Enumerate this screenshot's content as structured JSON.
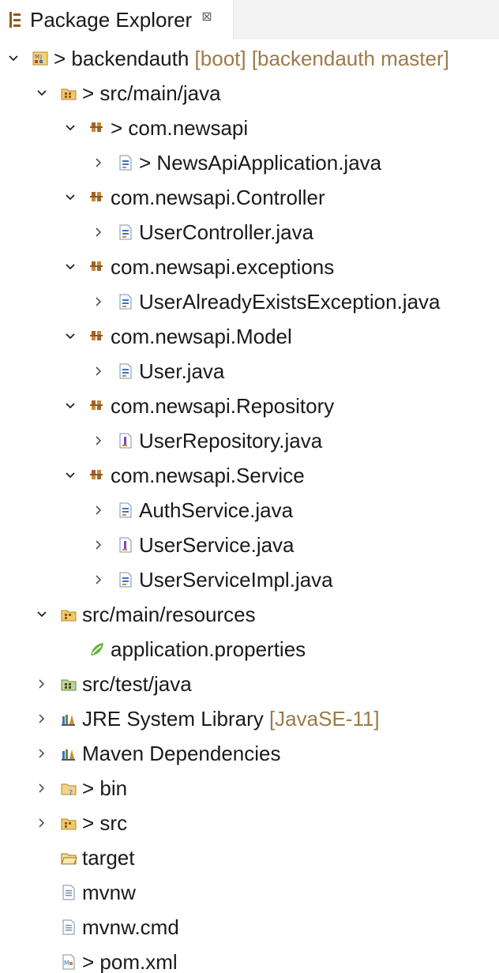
{
  "view": {
    "title": "Package Explorer",
    "close_glyph": "⊠",
    "icon": "package-explorer-icon"
  },
  "tree": [
    {
      "id": "project",
      "indent": 0,
      "twisty": "open",
      "icon": "maven-project-icon",
      "prefix": "> ",
      "label": "backendauth",
      "suffix": " [boot] [backendauth master]"
    },
    {
      "id": "src-main-java",
      "indent": 1,
      "twisty": "open",
      "icon": "source-folder-icon",
      "prefix": "> ",
      "label": "src/main/java",
      "suffix": ""
    },
    {
      "id": "pkg-newsapi",
      "indent": 2,
      "twisty": "open",
      "icon": "package-icon",
      "prefix": "> ",
      "label": "com.newsapi",
      "suffix": ""
    },
    {
      "id": "file-newsapiapplication",
      "indent": 3,
      "twisty": "closed",
      "icon": "java-class-icon",
      "prefix": "> ",
      "label": "NewsApiApplication.java",
      "suffix": ""
    },
    {
      "id": "pkg-controller",
      "indent": 2,
      "twisty": "open",
      "icon": "package-icon",
      "prefix": "",
      "label": "com.newsapi.Controller",
      "suffix": ""
    },
    {
      "id": "file-usercontroller",
      "indent": 3,
      "twisty": "closed",
      "icon": "java-class-icon",
      "prefix": "",
      "label": "UserController.java",
      "suffix": ""
    },
    {
      "id": "pkg-exceptions",
      "indent": 2,
      "twisty": "open",
      "icon": "package-icon",
      "prefix": "",
      "label": "com.newsapi.exceptions",
      "suffix": ""
    },
    {
      "id": "file-useralreadyexists",
      "indent": 3,
      "twisty": "closed",
      "icon": "java-class-icon",
      "prefix": "",
      "label": "UserAlreadyExistsException.java",
      "suffix": ""
    },
    {
      "id": "pkg-model",
      "indent": 2,
      "twisty": "open",
      "icon": "package-icon",
      "prefix": "",
      "label": "com.newsapi.Model",
      "suffix": ""
    },
    {
      "id": "file-user",
      "indent": 3,
      "twisty": "closed",
      "icon": "java-class-icon",
      "prefix": "",
      "label": "User.java",
      "suffix": ""
    },
    {
      "id": "pkg-repository",
      "indent": 2,
      "twisty": "open",
      "icon": "package-icon",
      "prefix": "",
      "label": "com.newsapi.Repository",
      "suffix": ""
    },
    {
      "id": "file-userrepository",
      "indent": 3,
      "twisty": "closed",
      "icon": "java-interface-icon",
      "prefix": "",
      "label": "UserRepository.java",
      "suffix": ""
    },
    {
      "id": "pkg-service",
      "indent": 2,
      "twisty": "open",
      "icon": "package-icon",
      "prefix": "",
      "label": "com.newsapi.Service",
      "suffix": ""
    },
    {
      "id": "file-authservice",
      "indent": 3,
      "twisty": "closed",
      "icon": "java-class-icon",
      "prefix": "",
      "label": "AuthService.java",
      "suffix": ""
    },
    {
      "id": "file-userservice",
      "indent": 3,
      "twisty": "closed",
      "icon": "java-interface-icon",
      "prefix": "",
      "label": "UserService.java",
      "suffix": ""
    },
    {
      "id": "file-userserviceimpl",
      "indent": 3,
      "twisty": "closed",
      "icon": "java-class-icon",
      "prefix": "",
      "label": "UserServiceImpl.java",
      "suffix": ""
    },
    {
      "id": "src-main-resources",
      "indent": 1,
      "twisty": "open",
      "icon": "resource-folder-icon",
      "prefix": "",
      "label": "src/main/resources",
      "suffix": ""
    },
    {
      "id": "file-application-properties",
      "indent": 2,
      "twisty": "none",
      "icon": "spring-properties-icon",
      "prefix": "",
      "label": "application.properties",
      "suffix": ""
    },
    {
      "id": "src-test-java",
      "indent": 1,
      "twisty": "closed",
      "icon": "test-source-folder-icon",
      "prefix": "",
      "label": "src/test/java",
      "suffix": ""
    },
    {
      "id": "jre-library",
      "indent": 1,
      "twisty": "closed",
      "icon": "library-icon",
      "prefix": "",
      "label": "JRE System Library",
      "suffix": " [JavaSE-11]"
    },
    {
      "id": "maven-dependencies",
      "indent": 1,
      "twisty": "closed",
      "icon": "library-icon",
      "prefix": "",
      "label": "Maven Dependencies",
      "suffix": ""
    },
    {
      "id": "folder-bin",
      "indent": 1,
      "twisty": "closed",
      "icon": "untracked-folder-icon",
      "prefix": "> ",
      "label": "bin",
      "suffix": ""
    },
    {
      "id": "folder-src",
      "indent": 1,
      "twisty": "closed",
      "icon": "changed-folder-icon",
      "prefix": "> ",
      "label": "src",
      "suffix": ""
    },
    {
      "id": "folder-target",
      "indent": 1,
      "twisty": "none",
      "icon": "folder-icon",
      "prefix": "",
      "label": "target",
      "suffix": ""
    },
    {
      "id": "file-mvnw",
      "indent": 1,
      "twisty": "none",
      "icon": "text-file-icon",
      "prefix": "",
      "label": "mvnw",
      "suffix": ""
    },
    {
      "id": "file-mvnw-cmd",
      "indent": 1,
      "twisty": "none",
      "icon": "text-file-icon",
      "prefix": "",
      "label": "mvnw.cmd",
      "suffix": ""
    },
    {
      "id": "file-pom",
      "indent": 1,
      "twisty": "none",
      "icon": "maven-pom-icon",
      "prefix": "> ",
      "label": "pom.xml",
      "suffix": ""
    }
  ],
  "colors": {
    "decoration": "#9c7a4a",
    "package_brown": "#8a5a1f",
    "java_blue": "#3b73c4",
    "spring_green": "#6db33f"
  }
}
